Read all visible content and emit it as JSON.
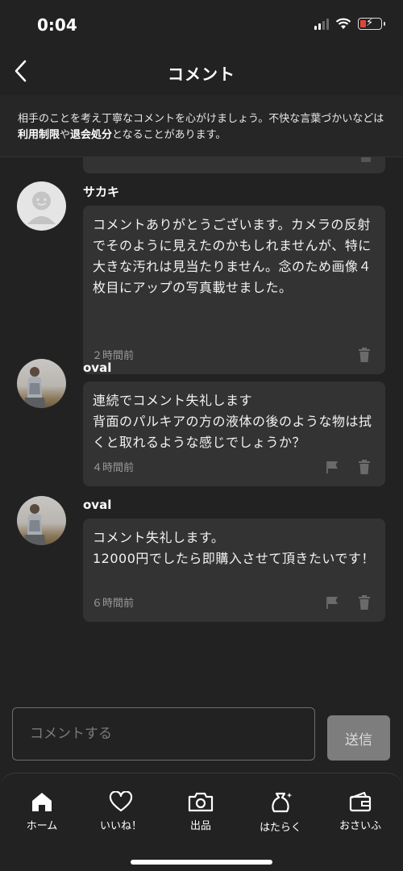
{
  "status": {
    "time": "0:04"
  },
  "header": {
    "title": "コメント"
  },
  "notice": {
    "part1": "相手のことを考え丁寧なコメントを心がけましょう。不快な言葉づかいなどは",
    "bold1": "利用制限",
    "part2": "や",
    "bold2": "退会処分",
    "part3": "となることがあります。"
  },
  "comments": [
    {
      "username": "サカキ",
      "text": "コメントありがとうございます。カメラの反射でそのように見えたのかもしれませんが、特に大きな汚れは見当たりません。念のため画像４枚目にアップの写真載せました。",
      "time": "２時間前"
    },
    {
      "username": "oval",
      "text": "連続でコメント失礼します\n背面のパルキアの方の液体の後のような物は拭くと取れるような感じでしょうか？",
      "time": "４時間前"
    },
    {
      "username": "oval",
      "text": "コメント失礼します。\n12000円でしたら即購入させて頂きたいです！",
      "time": "６時間前"
    }
  ],
  "composer": {
    "placeholder": "コメントする",
    "send_label": "送信"
  },
  "tabs": [
    {
      "label": "ホーム",
      "icon": "home-icon"
    },
    {
      "label": "いいね！",
      "icon": "heart-icon"
    },
    {
      "label": "出品",
      "icon": "camera-icon"
    },
    {
      "label": "はたらく",
      "icon": "money-bag-icon"
    },
    {
      "label": "おさいふ",
      "icon": "wallet-icon"
    }
  ]
}
